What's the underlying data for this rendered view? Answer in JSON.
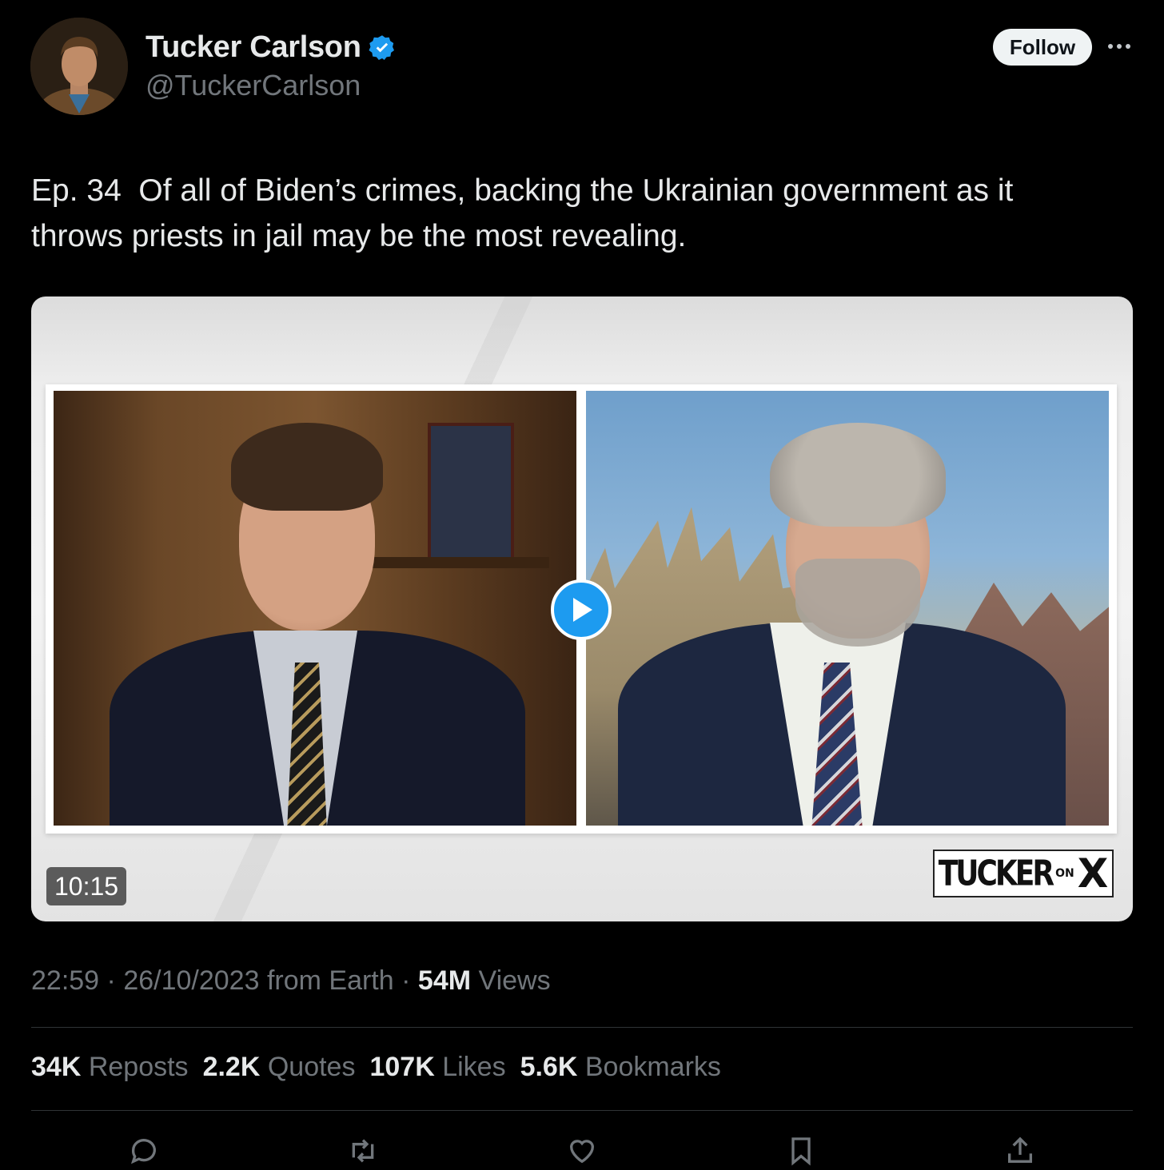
{
  "author": {
    "display_name": "Tucker Carlson",
    "handle": "@TuckerCarlson",
    "verified": true,
    "avatar_icon": "avatar"
  },
  "follow_label": "Follow",
  "more_icon": "more-icon",
  "tweet": {
    "text": "Ep. 34  Of all of Biden’s crimes, backing the Ukrainian government as it\nthrows priests in jail may be the most revealing."
  },
  "video": {
    "duration": "10:15",
    "logo_text_1": "TUCKER",
    "logo_text_2": "ON",
    "logo_text_3": "X"
  },
  "meta": {
    "time": "22:59",
    "date": "26/10/2023",
    "source": "from Earth",
    "views_count": "54M",
    "views_label": "Views"
  },
  "stats": {
    "reposts_count": "34K",
    "reposts_label": "Reposts",
    "quotes_count": "2.2K",
    "quotes_label": "Quotes",
    "likes_count": "107K",
    "likes_label": "Likes",
    "bookmarks_count": "5.6K",
    "bookmarks_label": "Bookmarks"
  },
  "colors": {
    "background": "#000000",
    "primary_text": "#e7e9ea",
    "secondary_text": "#71767b",
    "accent": "#1d9bf0"
  }
}
